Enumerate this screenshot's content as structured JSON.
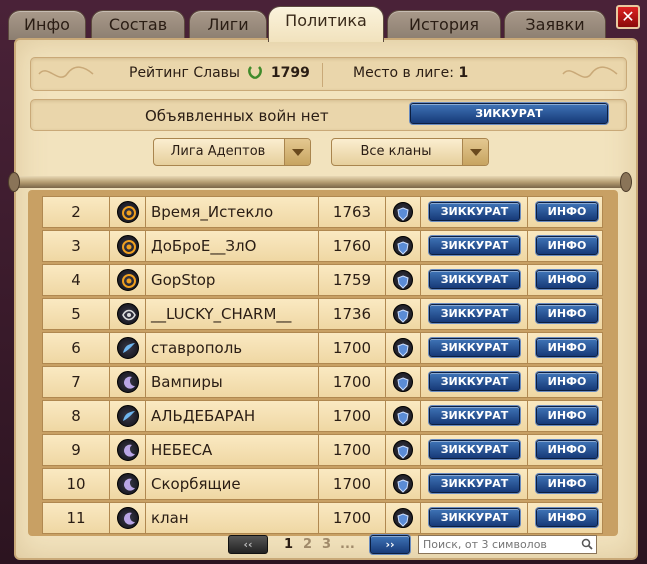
{
  "tabs": [
    {
      "label": "Инфо"
    },
    {
      "label": "Состав"
    },
    {
      "label": "Лиги"
    },
    {
      "label": "Политика"
    },
    {
      "label": "История"
    },
    {
      "label": "Заявки"
    }
  ],
  "active_tab": "Политика",
  "close_label": "✕",
  "rating": {
    "label": "Рейтинг Славы",
    "value": "1799"
  },
  "place": {
    "label": "Место в лиге:",
    "value": "1"
  },
  "wars": {
    "text": "Объявленных войн нет",
    "button": "ЗИККУРАТ"
  },
  "filters": {
    "league": "Лига Адептов",
    "clans": "Все кланы"
  },
  "rows": [
    {
      "rank": "2",
      "name": "Время_Истекло",
      "score": "1763",
      "zig": "ЗИККУРАТ",
      "info": "ИНФО",
      "emblem": "sun-emblem"
    },
    {
      "rank": "3",
      "name": "ДоБроЕ__ЗлО",
      "score": "1760",
      "zig": "ЗИККУРАТ",
      "info": "ИНФО",
      "emblem": "sun-emblem"
    },
    {
      "rank": "4",
      "name": "GopStop",
      "score": "1759",
      "zig": "ЗИККУРАТ",
      "info": "ИНФО",
      "emblem": "sun-emblem"
    },
    {
      "rank": "5",
      "name": "__LUCKY_CHARM__",
      "score": "1736",
      "zig": "ЗИККУРАТ",
      "info": "ИНФО",
      "emblem": "dark-emblem"
    },
    {
      "rank": "6",
      "name": "ставрополь",
      "score": "1700",
      "zig": "ЗИККУРАТ",
      "info": "ИНФО",
      "emblem": "wave-emblem"
    },
    {
      "rank": "7",
      "name": "Вампиры",
      "score": "1700",
      "zig": "ЗИККУРАТ",
      "info": "ИНФО",
      "emblem": "moon-emblem"
    },
    {
      "rank": "8",
      "name": "АЛЬДЕБАРАН",
      "score": "1700",
      "zig": "ЗИККУРАТ",
      "info": "ИНФО",
      "emblem": "wave-emblem"
    },
    {
      "rank": "9",
      "name": "НЕБЕСА",
      "score": "1700",
      "zig": "ЗИККУРАТ",
      "info": "ИНФО",
      "emblem": "moon-emblem"
    },
    {
      "rank": "10",
      "name": "Скорбящие",
      "score": "1700",
      "zig": "ЗИККУРАТ",
      "info": "ИНФО",
      "emblem": "moon-emblem"
    },
    {
      "rank": "11",
      "name": "клан",
      "score": "1700",
      "zig": "ЗИККУРАТ",
      "info": "ИНФО",
      "emblem": "moon-emblem"
    }
  ],
  "pager": {
    "prev": "‹‹",
    "next": "››",
    "pages": [
      "1",
      "2",
      "3",
      "..."
    ],
    "current": "1"
  },
  "search": {
    "placeholder": "Поиск, от 3 символов"
  },
  "colors": {
    "parchment": "#f2e3be",
    "button_blue": "#2a5596",
    "frame": "#3a1d2c"
  }
}
